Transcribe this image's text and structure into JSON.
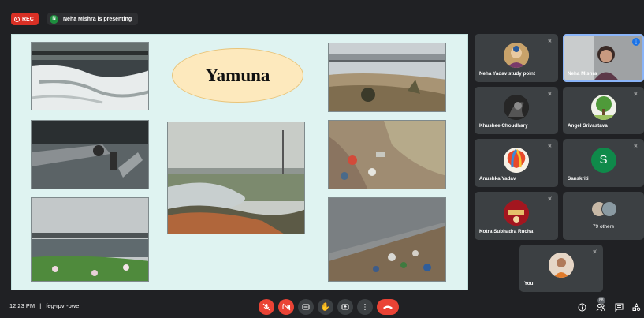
{
  "recording": {
    "label": "REC"
  },
  "presenter": {
    "initial": "N",
    "text": "Neha Mishra is presenting"
  },
  "slide": {
    "title": "Yamuna"
  },
  "participants": [
    {
      "name": "Neha Yadav study point",
      "muted": true,
      "avatar": "photo-deity"
    },
    {
      "name": "Neha Mishra",
      "muted": false,
      "speaking": true,
      "avatar": "video-woman"
    },
    {
      "name": "Khushee Choudhary",
      "muted": true,
      "avatar": "photo-dark"
    },
    {
      "name": "Angel Srivastava",
      "muted": true,
      "avatar": "photo-tree"
    },
    {
      "name": "Anushka Yadav",
      "muted": true,
      "avatar": "photo-balloon"
    },
    {
      "name": "Sanskriti",
      "muted": true,
      "initial": "S",
      "avatar_color": "#0f8a4a"
    },
    {
      "name": "Kotra Subhadra Rucha",
      "muted": true,
      "avatar": "photo-red"
    },
    {
      "others_label": "79 others"
    },
    {
      "name": "You",
      "muted": true,
      "avatar": "photo-self"
    }
  ],
  "meeting": {
    "time": "12:23 PM",
    "code": "feg-rpvr-bwe",
    "separator": "|"
  },
  "controls": [
    "mic-off",
    "camera-off",
    "captions",
    "raise-hand",
    "present",
    "more-options",
    "end-call"
  ],
  "right_controls": {
    "people_count": "88",
    "icons": [
      "info",
      "people",
      "chat",
      "activities"
    ]
  },
  "colors": {
    "accent": "#8ab4f8",
    "danger": "#ea4335",
    "background": "#202124",
    "tile": "#3c4043"
  }
}
